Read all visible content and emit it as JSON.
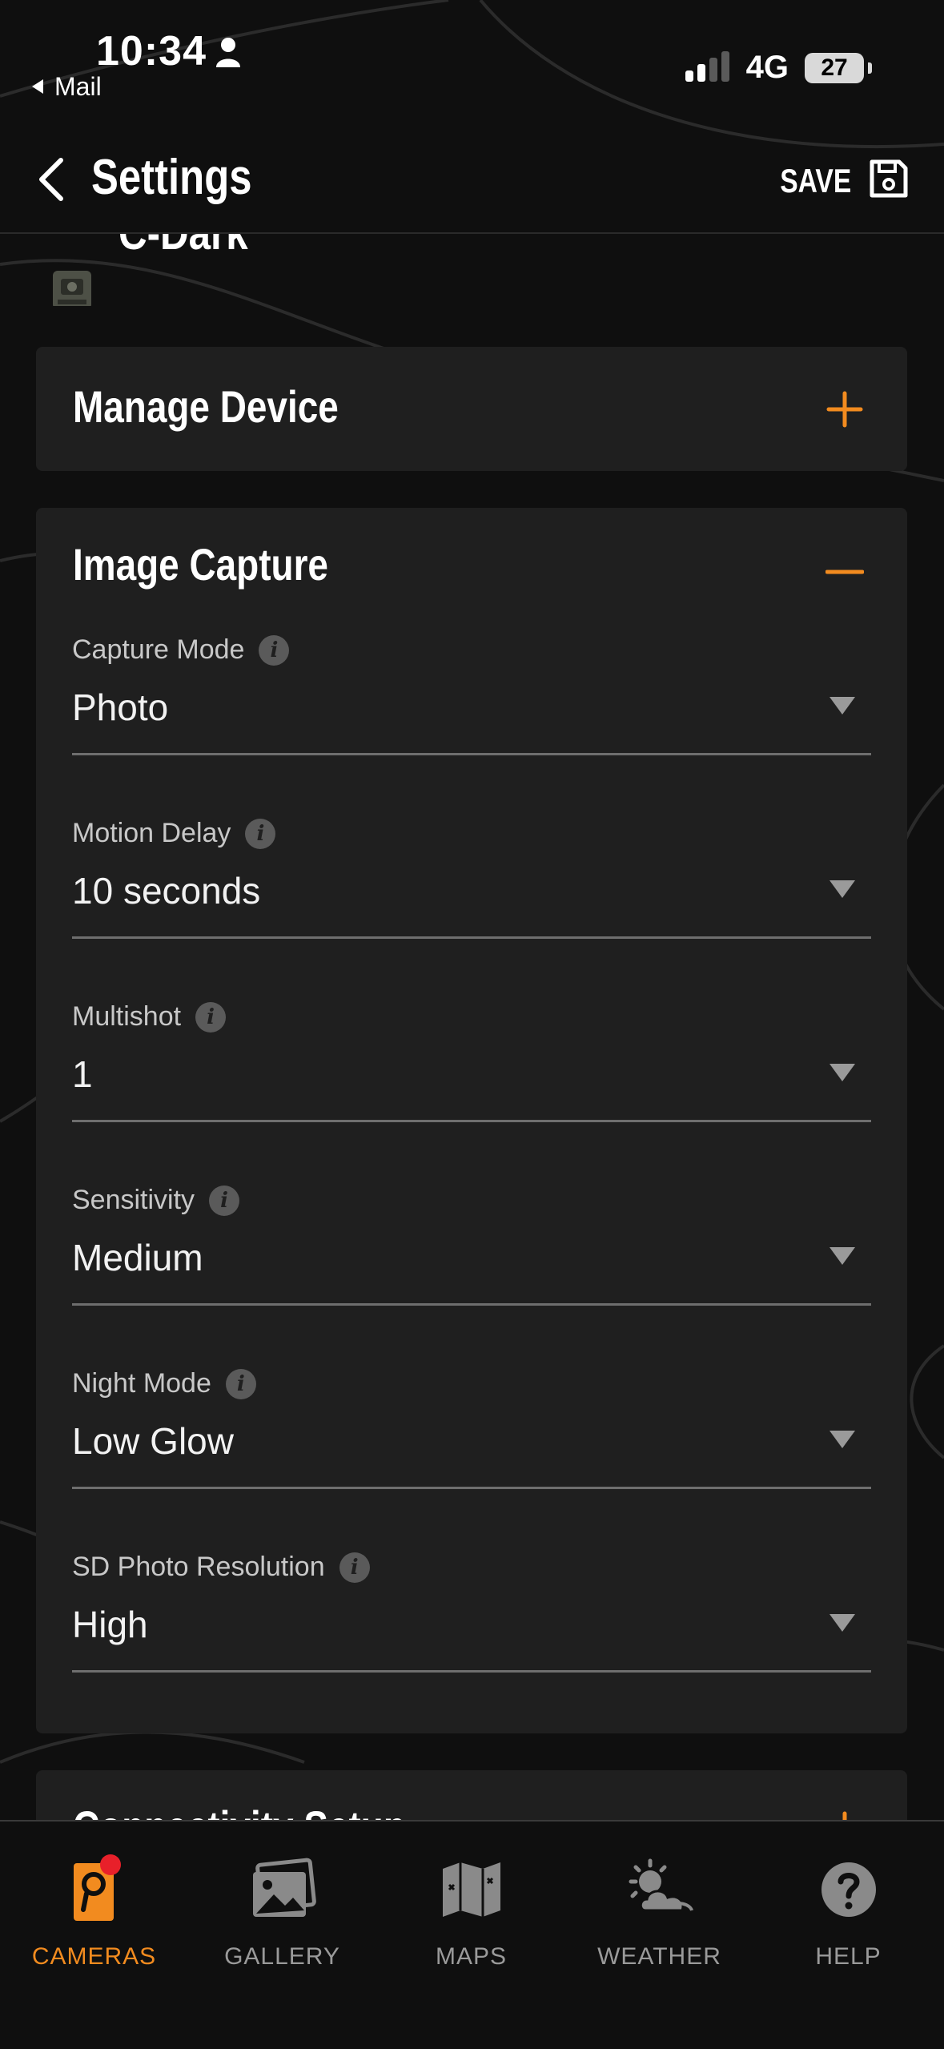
{
  "status_bar": {
    "time": "10:34",
    "back_app": "Mail",
    "network": "4G",
    "battery": "27"
  },
  "header": {
    "title": "Settings",
    "save_label": "SAVE"
  },
  "device": {
    "name": "C-Dark"
  },
  "sections": {
    "manage_device": {
      "title": "Manage Device",
      "toggle_icon": "plus-icon"
    },
    "image_capture": {
      "title": "Image Capture",
      "toggle_icon": "minus-icon",
      "fields": [
        {
          "label": "Capture Mode",
          "value": "Photo"
        },
        {
          "label": "Motion Delay",
          "value": "10 seconds"
        },
        {
          "label": "Multishot",
          "value": "1"
        },
        {
          "label": "Sensitivity",
          "value": "Medium"
        },
        {
          "label": "Night Mode",
          "value": "Low Glow"
        },
        {
          "label": "SD Photo Resolution",
          "value": "High"
        }
      ]
    },
    "connectivity": {
      "title": "Connectivity Setup",
      "toggle_icon": "plus-icon"
    }
  },
  "nav": {
    "items": [
      {
        "label": "CAMERAS",
        "icon": "camera-icon",
        "active": true,
        "badge": true
      },
      {
        "label": "GALLERY",
        "icon": "gallery-icon"
      },
      {
        "label": "MAPS",
        "icon": "map-icon"
      },
      {
        "label": "WEATHER",
        "icon": "weather-icon"
      },
      {
        "label": "HELP",
        "icon": "help-icon"
      }
    ]
  },
  "colors": {
    "accent": "#f28b1f",
    "card_bg": "#1f1f1f",
    "page_bg": "#0f0f0f",
    "badge": "#e8202a"
  }
}
